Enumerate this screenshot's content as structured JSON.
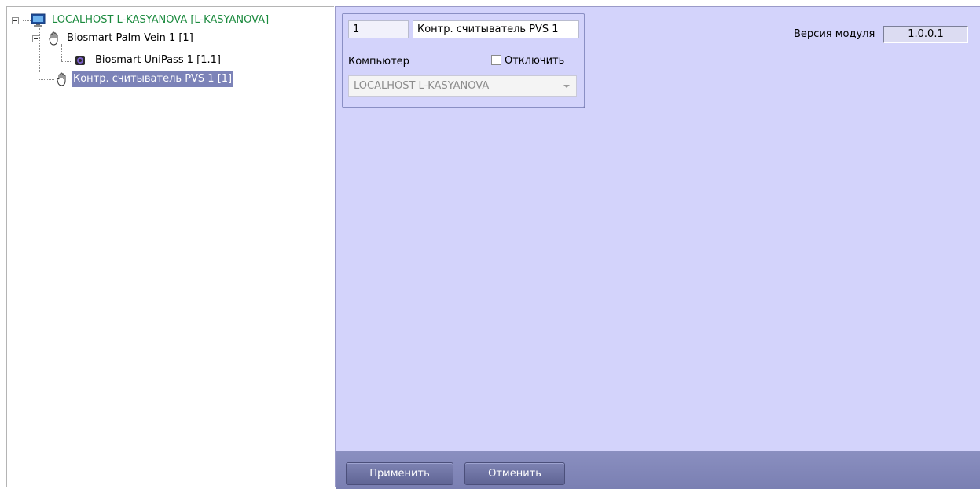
{
  "tree": {
    "root_label": "LOCALHOST L-KASYANOVA [L-KASYANOVA]",
    "child1_label": "Biosmart Palm Vein 1 [1]",
    "grandchild_label": "Biosmart UniPass 1 [1.1]",
    "selected_label": "Контр. считыватель PVS 1 [1]"
  },
  "form": {
    "id_value": "1",
    "name_value": "Контр. считыватель PVS 1",
    "computer_label": "Компьютер",
    "disable_label": "Отключить",
    "disable_checked": false,
    "computer_value": "LOCALHOST L-KASYANOVA",
    "version_label": "Версия модуля",
    "version_value": "1.0.0.1"
  },
  "buttons": {
    "apply": "Применить",
    "cancel": "Отменить"
  },
  "icons": {
    "computer": "monitor-icon",
    "hand": "palm-hand-icon",
    "reader": "reader-device-icon"
  },
  "colors": {
    "panel_bg": "#d3d3fb",
    "selection_bg": "#7c83b8",
    "root_text": "#1b8a3e",
    "bottom_bar": "#8a8fc0"
  }
}
